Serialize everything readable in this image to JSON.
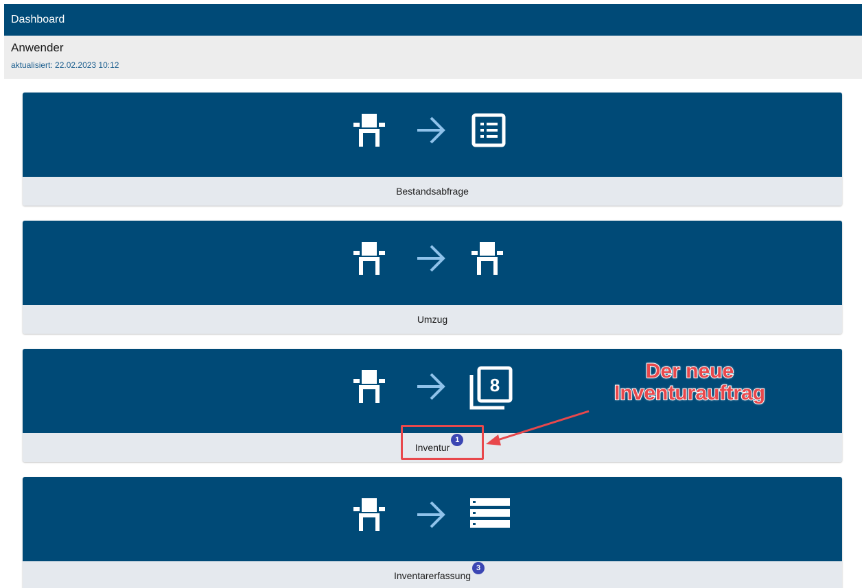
{
  "header": {
    "title": "Dashboard"
  },
  "subheader": {
    "user": "Anwender",
    "updated": "aktualisiert: 22.02.2023 10:12"
  },
  "tiles": [
    {
      "label": "Bestandsabfrage",
      "icon_left": "chair-icon",
      "icon_arrow": "arrow-right-icon",
      "icon_right": "list-icon"
    },
    {
      "label": "Umzug",
      "icon_left": "chair-icon",
      "icon_arrow": "arrow-right-icon",
      "icon_right": "chair-icon"
    },
    {
      "label": "Inventur",
      "badge": "1",
      "icon_left": "chair-icon",
      "icon_arrow": "arrow-right-icon",
      "icon_right": "filter-8-icon"
    },
    {
      "label": "Inventarerfassung",
      "badge": "3",
      "icon_left": "chair-icon",
      "icon_arrow": "arrow-right-icon",
      "icon_right": "storage-icon"
    }
  ],
  "annotation": {
    "text_line1": "Der neue",
    "text_line2": "Inventurauftrag"
  },
  "colors": {
    "primary": "#004a77",
    "caption_bg": "#e5e9ee",
    "badge": "#3b46b3",
    "annotation": "#e8484c"
  }
}
